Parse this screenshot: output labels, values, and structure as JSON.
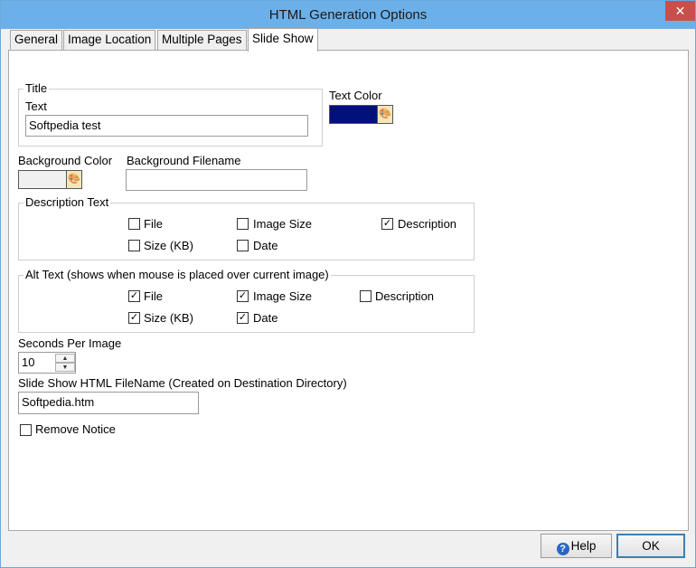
{
  "window": {
    "title": "HTML Generation Options",
    "close": "✕"
  },
  "tabs": [
    "General",
    "Image Location",
    "Multiple Pages",
    "Slide Show"
  ],
  "title_group": {
    "legend": "Title",
    "text_label": "Text",
    "text_value": "Softpedia test",
    "text_color_label": "Text Color",
    "text_color": "#02107a"
  },
  "background": {
    "color_label": "Background Color",
    "color": "#f0f0f0",
    "filename_label": "Background Filename",
    "filename_value": ""
  },
  "description_text": {
    "legend": "Description Text",
    "options": [
      {
        "label": "File",
        "checked": false
      },
      {
        "label": "Image Size",
        "checked": false
      },
      {
        "label": "Description",
        "checked": true
      },
      {
        "label": "Size (KB)",
        "checked": false
      },
      {
        "label": "Date",
        "checked": false
      }
    ]
  },
  "alt_text": {
    "legend": "Alt Text (shows when mouse is placed over current image)",
    "options": [
      {
        "label": "File",
        "checked": true
      },
      {
        "label": "Image Size",
        "checked": true
      },
      {
        "label": "Description",
        "checked": false
      },
      {
        "label": "Size (KB)",
        "checked": true
      },
      {
        "label": "Date",
        "checked": true
      }
    ]
  },
  "seconds": {
    "label": "Seconds Per Image",
    "value": "10"
  },
  "slideshow_file": {
    "label": "Slide Show HTML FileName (Created on Destination Directory)",
    "value": "Softpedia.htm"
  },
  "remove_notice": {
    "label": "Remove Notice",
    "checked": false
  },
  "buttons": {
    "help": "Help",
    "ok": "OK"
  },
  "icons": {
    "palette": "palette-icon",
    "help": "help-icon"
  }
}
